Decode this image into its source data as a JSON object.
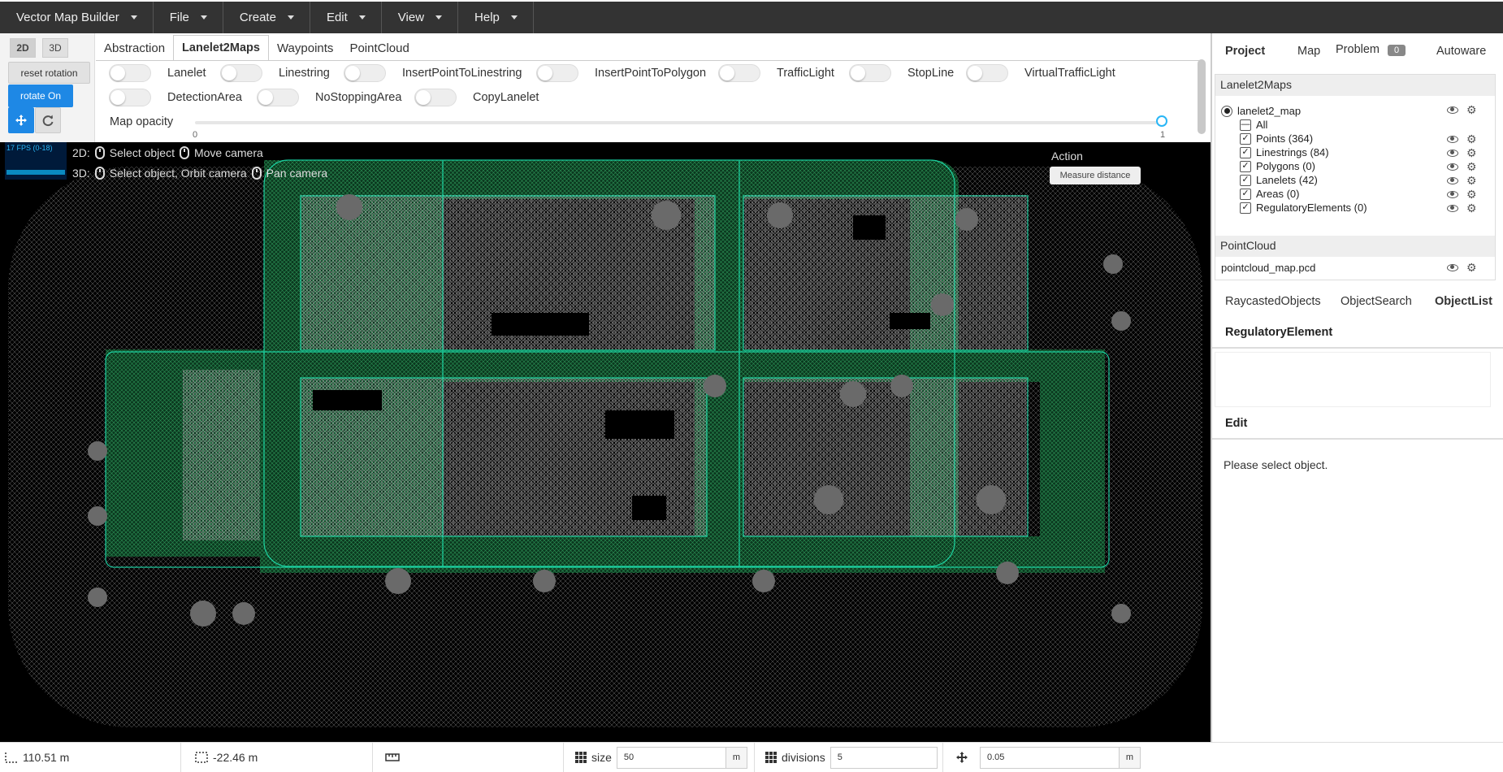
{
  "menubar": {
    "items": [
      "Vector Map Builder",
      "File",
      "Create",
      "Edit",
      "View",
      "Help"
    ]
  },
  "mode": {
    "btn_2d": "2D",
    "btn_3d": "3D",
    "reset_rotation": "reset rotation",
    "rotate": "rotate On",
    "move_icon": "move-icon",
    "refresh_icon": "refresh-icon"
  },
  "tabs": [
    "Abstraction",
    "Lanelet2Maps",
    "Waypoints",
    "PointCloud"
  ],
  "active_tab": "Lanelet2Maps",
  "toggles_row1": [
    "Lanelet",
    "Linestring",
    "InsertPointToLinestring",
    "InsertPointToPolygon",
    "TrafficLight",
    "StopLine",
    "VirtualTrafficLight"
  ],
  "toggles_row2": [
    "DetectionArea",
    "NoStoppingArea",
    "CopyLanelet"
  ],
  "opacity": {
    "label": "Map opacity",
    "min": "0",
    "max": "1",
    "value": 1
  },
  "viewport": {
    "fps": "17 FPS (0-18)",
    "hint_2d_prefix": "2D:",
    "hint_2d_a": "Select object",
    "hint_2d_b": "Move camera",
    "hint_3d_prefix": "3D:",
    "hint_3d_a": "Select object, Orbit camera",
    "hint_3d_b": "Pan camera",
    "action_label": "Action",
    "measure_button": "Measure distance",
    "accent_color": "#1de9b6"
  },
  "rightpanel": {
    "tabs": [
      "Project",
      "Map",
      "Problem",
      "Autoware"
    ],
    "problem_count": "0",
    "lanelet_section": "Lanelet2Maps",
    "map_name": "lanelet2_map",
    "tree": [
      {
        "label": "All",
        "check": "—"
      },
      {
        "label": "Points (364)",
        "check": "✓"
      },
      {
        "label": "Linestrings (84)",
        "check": "✓"
      },
      {
        "label": "Polygons (0)",
        "check": "✓"
      },
      {
        "label": "Lanelets (42)",
        "check": "✓"
      },
      {
        "label": "Areas (0)",
        "check": "✓"
      },
      {
        "label": "RegulatoryElements (0)",
        "check": "✓"
      }
    ],
    "pointcloud_section": "PointCloud",
    "pointcloud_file": "pointcloud_map.pcd",
    "object_tabs": [
      "RaycastedObjects",
      "ObjectSearch",
      "ObjectList"
    ],
    "regulatory_header": "RegulatoryElement",
    "edit_header": "Edit",
    "edit_message": "Please select object."
  },
  "statusbar": {
    "x_value": "110.51 m",
    "y_value": "-22.46 m",
    "size_label": "size",
    "size_value": "50",
    "size_unit": "m",
    "divisions_label": "divisions",
    "divisions_value": "5",
    "step_value": "0.05",
    "step_unit": "m"
  }
}
